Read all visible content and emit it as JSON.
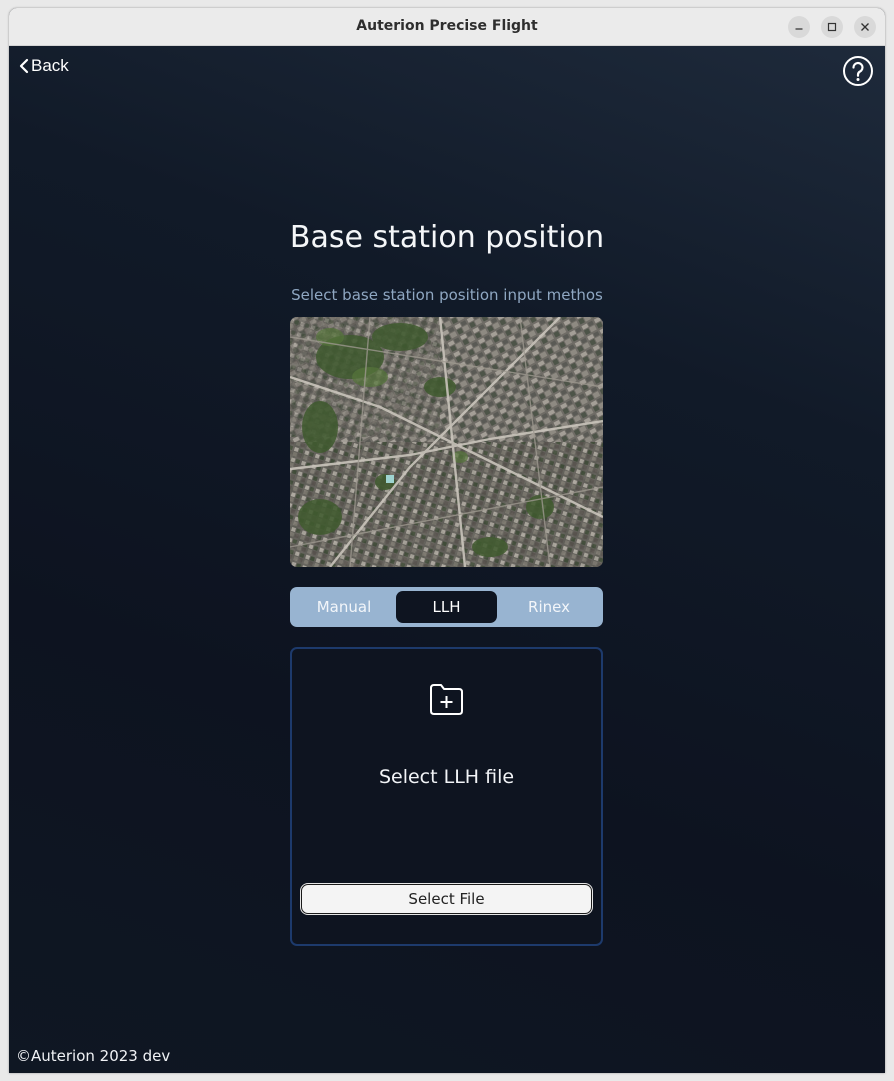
{
  "window": {
    "title": "Auterion Precise Flight",
    "controls": [
      "minimize-icon",
      "maximize-icon",
      "close-icon"
    ]
  },
  "nav": {
    "back_label": "Back",
    "back_icon": "chevron-left-icon",
    "help_icon": "help-circle-icon"
  },
  "main": {
    "title": "Base station position",
    "subtitle": "Select base station position input methos",
    "map_image": "satellite-map",
    "methods": [
      {
        "label": "Manual",
        "active": false
      },
      {
        "label": "LLH",
        "active": true
      },
      {
        "label": "Rinex",
        "active": false
      }
    ],
    "file_card": {
      "icon": "folder-add-icon",
      "label": "Select LLH file",
      "button_label": "Select File"
    }
  },
  "footer": {
    "text": "©Auterion 2023 dev"
  },
  "colors": {
    "background": "#0e1420",
    "segment_bg": "#98b4d1",
    "card_border": "#1d3a6c",
    "subtitle": "#8fa7c2"
  }
}
